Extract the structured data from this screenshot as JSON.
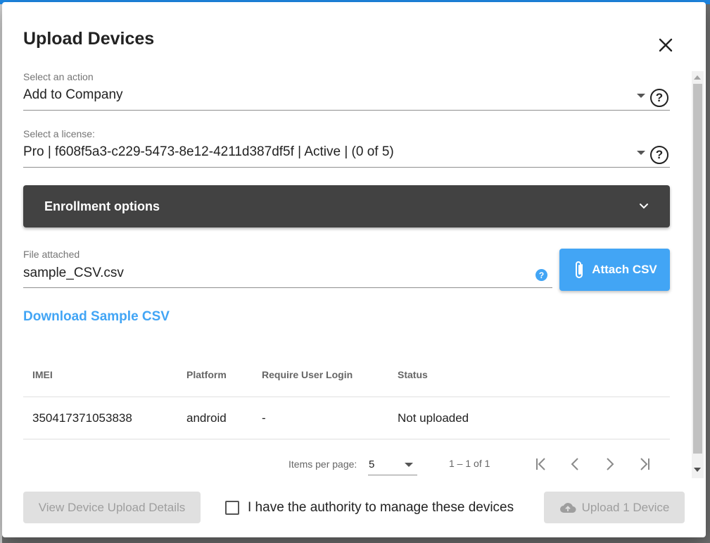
{
  "dialog": {
    "title": "Upload Devices",
    "close_icon": "close-icon"
  },
  "action": {
    "label": "Select an action",
    "value": "Add to Company"
  },
  "license": {
    "label": "Select a license:",
    "value": "Pro | f608f5a3-c229-5473-8e12-4211d387df5f | Active | (0 of 5)"
  },
  "enrollment": {
    "title": "Enrollment options"
  },
  "file": {
    "label": "File attached",
    "value": "sample_CSV.csv",
    "attach_label": "Attach CSV"
  },
  "download_link": "Download Sample CSV",
  "table": {
    "columns": [
      "IMEI",
      "Platform",
      "Require User Login",
      "Status"
    ],
    "rows": [
      [
        "350417371053838",
        "android",
        "-",
        "Not uploaded"
      ]
    ]
  },
  "pagination": {
    "items_per_page_label": "Items per page:",
    "items_per_page": "5",
    "range": "1 – 1 of 1"
  },
  "footer": {
    "view_details_label": "View Device Upload Details",
    "authority_label": "I have the authority to manage these devices",
    "upload_label": "Upload 1 Device"
  },
  "colors": {
    "accent": "#42a5f5",
    "enrollment_bar": "#424242",
    "disabled_button": "#e0e0e0"
  }
}
